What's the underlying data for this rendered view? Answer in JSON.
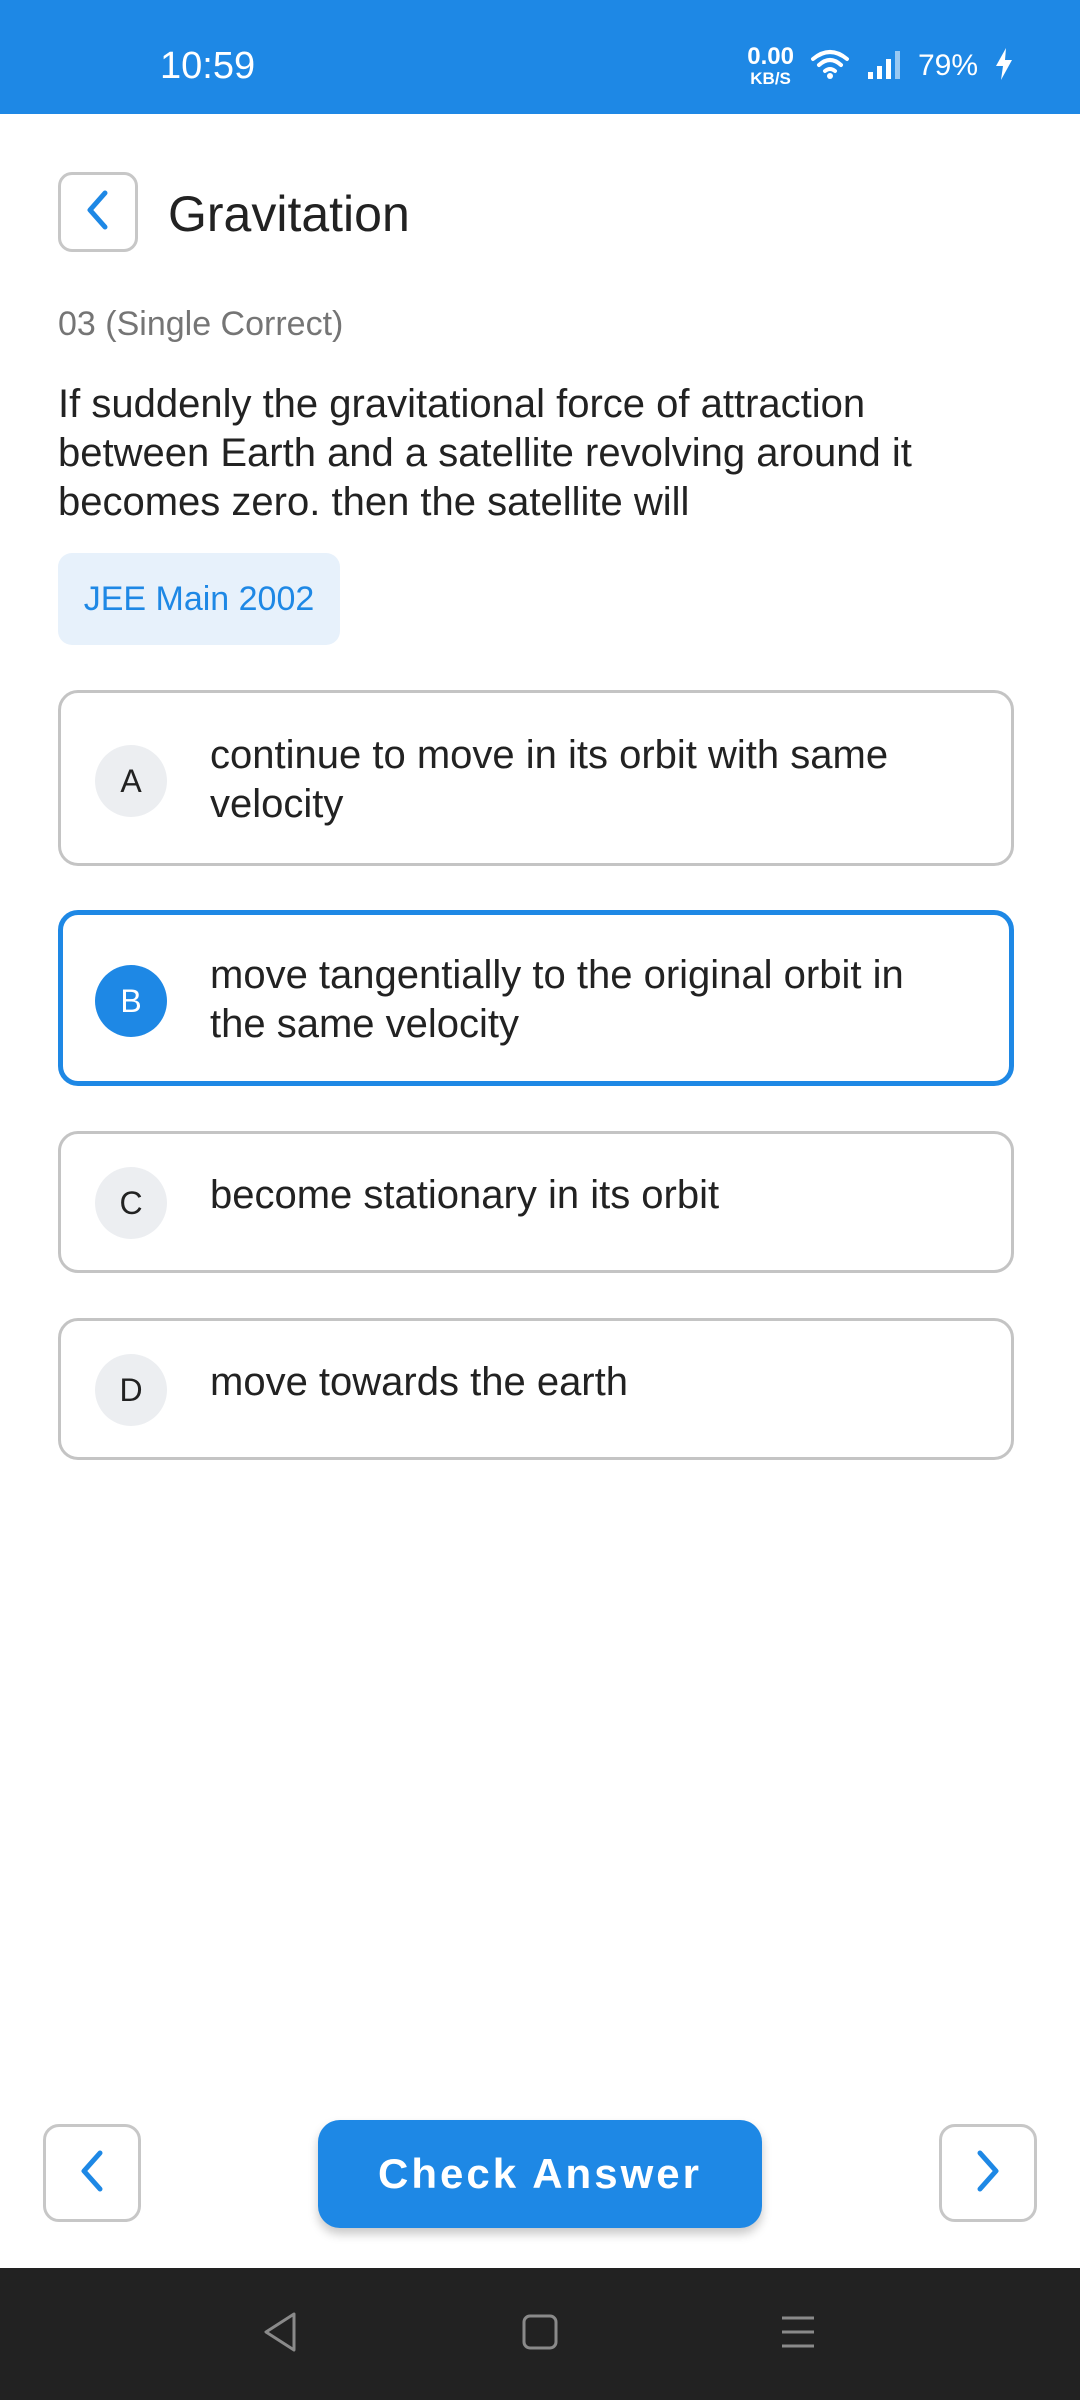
{
  "status_bar": {
    "time": "10:59",
    "net_speed_value": "0.00",
    "net_speed_unit": "KB/S",
    "battery": "79%",
    "icons": [
      "wifi-icon",
      "signal-icon",
      "charging-bolt-icon"
    ],
    "background_color": "#1e88e5"
  },
  "header": {
    "back_icon": "chevron-left-icon",
    "title": "Gravitation"
  },
  "question": {
    "meta": "03 (Single Correct)",
    "text": "If suddenly the gravitational force of attraction between Earth and a satellite revolving around it becomes zero. then the satellite will",
    "tag": "JEE Main 2002"
  },
  "options": [
    {
      "letter": "A",
      "text": "continue to move in its orbit with same velocity",
      "selected": false
    },
    {
      "letter": "B",
      "text": "move tangentially to the original orbit in the same velocity",
      "selected": true
    },
    {
      "letter": "C",
      "text": "become stationary in its orbit",
      "selected": false
    },
    {
      "letter": "D",
      "text": "move towards the earth",
      "selected": false
    }
  ],
  "footer": {
    "prev_icon": "chevron-left-icon",
    "next_icon": "chevron-right-icon",
    "check_label": "Check Answer"
  },
  "system_nav": {
    "icons": [
      "back-triangle-icon",
      "home-square-icon",
      "recents-menu-icon"
    ]
  },
  "colors": {
    "accent": "#1e88e5",
    "tag_background": "#e7f1fb",
    "option_border": "#c4c4c4",
    "letter_background": "#eceef1"
  }
}
